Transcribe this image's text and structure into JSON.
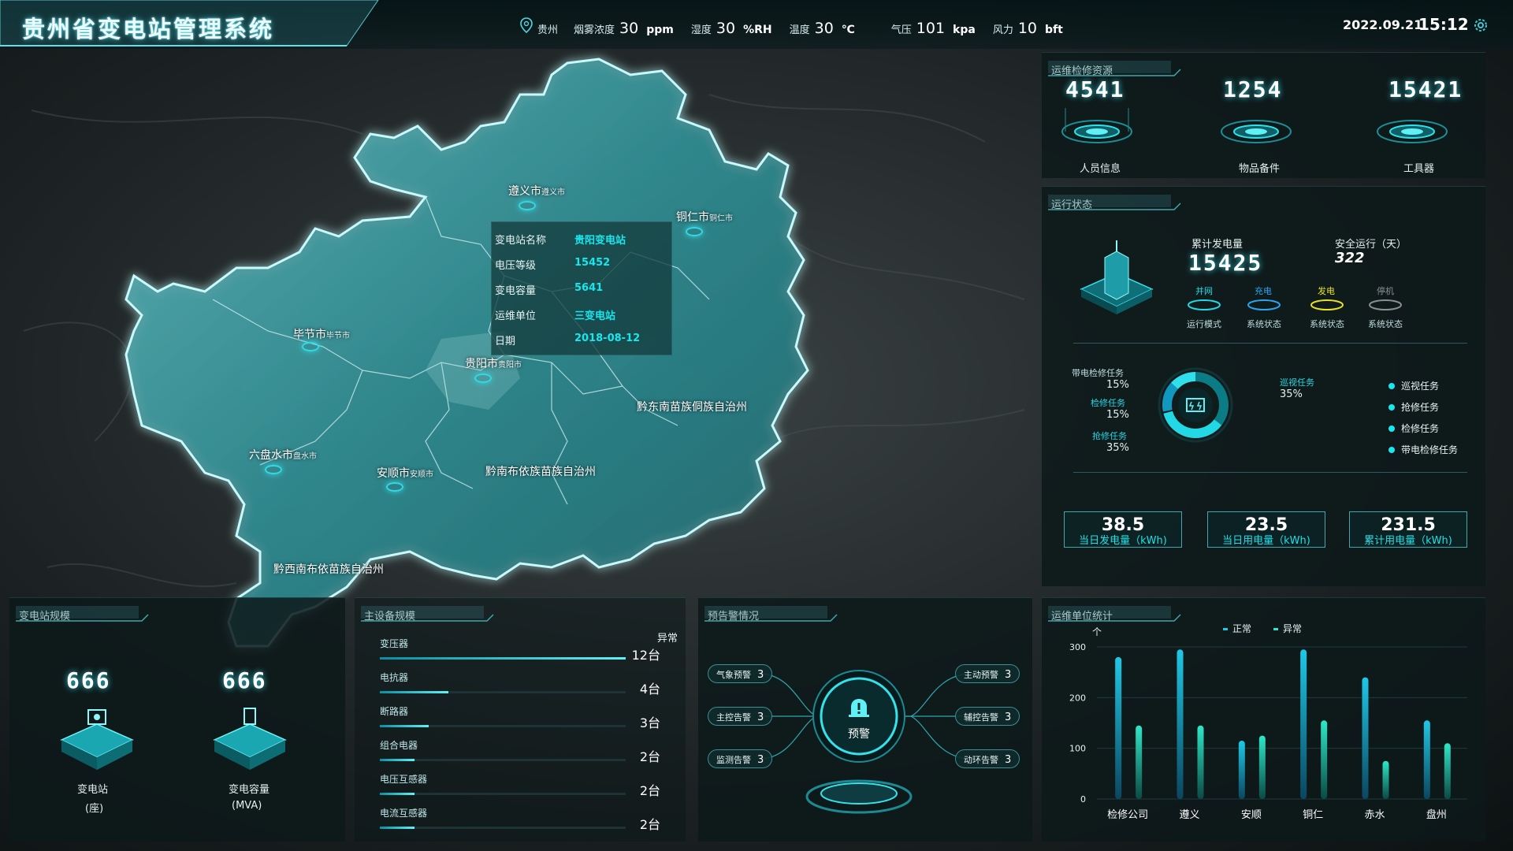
{
  "header": {
    "title": "贵州省变电站管理系统",
    "location": "贵州",
    "weather": [
      {
        "label": "烟雾浓度",
        "value": "30",
        "unit": "ppm"
      },
      {
        "label": "湿度",
        "value": "30",
        "unit": "%RH"
      },
      {
        "label": "温度",
        "value": "30",
        "unit": "℃"
      },
      {
        "label": "气压",
        "value": "101",
        "unit": "kpa"
      },
      {
        "label": "风力",
        "value": "10",
        "unit": "bft"
      }
    ],
    "date": "2022.09.21",
    "time": "15:12"
  },
  "map": {
    "cities": [
      {
        "name": "遵义市",
        "small": "遵义市"
      },
      {
        "name": "铜仁市",
        "small": "铜仁市"
      },
      {
        "name": "毕节市",
        "small": "毕节市"
      },
      {
        "name": "贵阳市",
        "small": "贵阳市"
      },
      {
        "name": "六盘水市",
        "small": "盘水市"
      },
      {
        "name": "安顺市",
        "small": "安顺市"
      }
    ],
    "regions": [
      "黔东南苗族侗族自治州",
      "黔南布依族苗族自治州",
      "黔西南布依苗族自治州"
    ],
    "tooltip": [
      {
        "k": "变电站名称",
        "v": "贵阳变电站"
      },
      {
        "k": "电压等级",
        "v": "15452"
      },
      {
        "k": "变电容量",
        "v": "5641"
      },
      {
        "k": "运维单位",
        "v": "三变电站"
      },
      {
        "k": "日期",
        "v": "2018-08-12"
      }
    ]
  },
  "resources": {
    "title": "运维检修资源",
    "items": [
      {
        "value": "4541",
        "label": "人员信息"
      },
      {
        "value": "1254",
        "label": "物品备件"
      },
      {
        "value": "15421",
        "label": "工具器"
      }
    ]
  },
  "status": {
    "title": "运行状态",
    "gen_label": "累计发电量",
    "gen_value": "15425",
    "safe_label": "安全运行（天）",
    "safe_value": "322",
    "modes": [
      {
        "top": "并网",
        "bottom": "运行模式",
        "color": "#21d8e4"
      },
      {
        "top": "充电",
        "bottom": "系统状态",
        "color": "#2aa4f0"
      },
      {
        "top": "发电",
        "bottom": "系统状态",
        "color": "#e8e021"
      },
      {
        "top": "停机",
        "bottom": "系统状态",
        "color": "#8a8f90"
      }
    ],
    "tasks_left": [
      {
        "label": "带电检修任务",
        "pct": "15%"
      },
      {
        "label": "检修任务",
        "pct": "15%"
      },
      {
        "label": "抢修任务",
        "pct": "35%"
      }
    ],
    "task_right": {
      "label": "巡视任务",
      "pct": "35%"
    },
    "task_legend": [
      "巡视任务",
      "抢修任务",
      "检修任务",
      "带电检修任务"
    ],
    "kpis": [
      {
        "value": "38.5",
        "label": "当日发电量（kWh)"
      },
      {
        "value": "23.5",
        "label": "当日用电量（kWh)"
      },
      {
        "value": "231.5",
        "label": "累计用电量（kWh)"
      }
    ]
  },
  "scale": {
    "title": "变电站规模",
    "items": [
      {
        "value": "666",
        "label": "变电站",
        "unit": "(座)"
      },
      {
        "value": "666",
        "label": "变电容量",
        "unit": "(MVA)"
      }
    ]
  },
  "equipment": {
    "title": "主设备规模",
    "status_label": "异常",
    "items": [
      {
        "name": "变压器",
        "count": "12台",
        "fill": 1.0
      },
      {
        "name": "电抗器",
        "count": "4台",
        "fill": 0.28
      },
      {
        "name": "断路器",
        "count": "3台",
        "fill": 0.2
      },
      {
        "name": "组合电器",
        "count": "2台",
        "fill": 0.14
      },
      {
        "name": "电压互感器",
        "count": "2台",
        "fill": 0.14
      },
      {
        "name": "电流互感器",
        "count": "2台",
        "fill": 0.14
      }
    ]
  },
  "warnings": {
    "title": "预告警情况",
    "center_label": "预警",
    "left": [
      {
        "label": "气象预警",
        "n": "3"
      },
      {
        "label": "主控告警",
        "n": "3"
      },
      {
        "label": "监测告警",
        "n": "3"
      }
    ],
    "right": [
      {
        "label": "主动预警",
        "n": "3"
      },
      {
        "label": "辅控告警",
        "n": "3"
      },
      {
        "label": "动环告警",
        "n": "3"
      }
    ]
  },
  "stats": {
    "title": "运维单位统计",
    "unit_label": "个"
  },
  "chart_data": {
    "type": "bar",
    "title": "运维单位统计",
    "ylabel": "个",
    "categories": [
      "检修公司",
      "遵义",
      "安顺",
      "铜仁",
      "赤水",
      "盘州"
    ],
    "series": [
      {
        "name": "正常",
        "values": [
          280,
          295,
          115,
          295,
          240,
          155
        ]
      },
      {
        "name": "异常",
        "values": [
          145,
          145,
          125,
          155,
          75,
          110
        ]
      }
    ],
    "yticks": [
      "0",
      "100",
      "200",
      "300"
    ],
    "ylim": [
      0,
      300
    ],
    "legend": "top"
  }
}
